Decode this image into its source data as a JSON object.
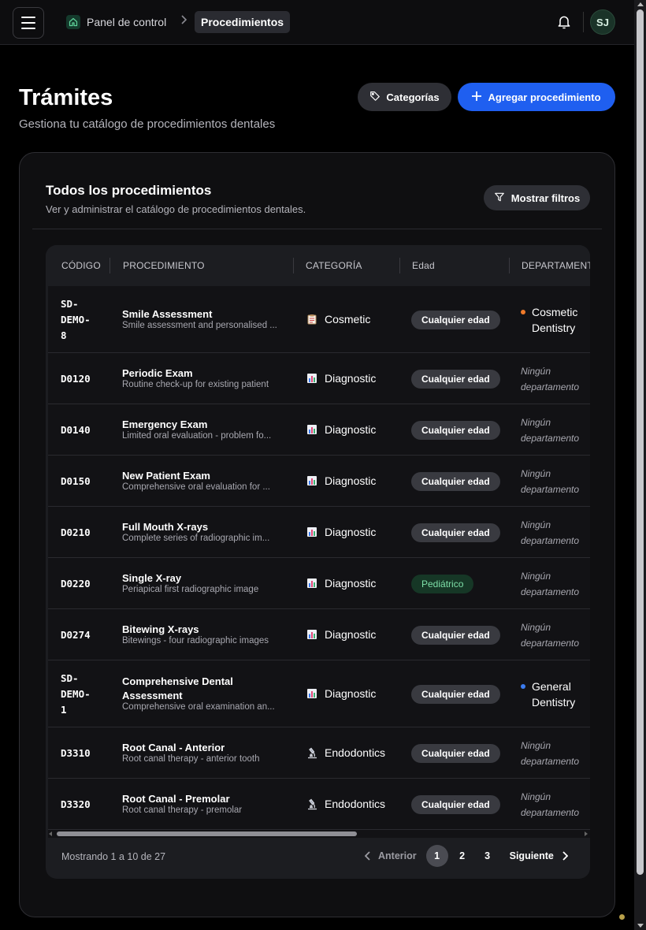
{
  "topbar": {
    "breadcrumb_home": "Panel de control",
    "breadcrumb_current": "Procedimientos",
    "avatar_initials": "SJ"
  },
  "header": {
    "title": "Trámites",
    "subtitle": "Gestiona tu catálogo de procedimientos dentales",
    "categories_button": "Categorías",
    "add_button": "Agregar procedimiento"
  },
  "card": {
    "title": "Todos los procedimientos",
    "subtitle": "Ver y administrar el catálogo de procedimientos dentales.",
    "filter_button": "Mostrar filtros"
  },
  "table": {
    "columns": [
      "CÓDIGO",
      "PROCEDIMIENTO",
      "CATEGORÍA",
      "Edad",
      "DEPARTAMENT"
    ],
    "rows": [
      {
        "code": "SD-DEMO-8",
        "name": "Smile Assessment",
        "desc": "Smile assessment and personalised ...",
        "category": "Cosmetic",
        "cat_icon": "clipboard-icon",
        "age": "Cualquier edad",
        "dept": "Cosmetic Dentistry",
        "dept_color": "#f07a2a"
      },
      {
        "code": "D0120",
        "name": "Periodic Exam",
        "desc": "Routine check-up for existing patient",
        "category": "Diagnostic",
        "cat_icon": "bar-chart-icon",
        "age": "Cualquier edad",
        "dept": "Ningún departamento"
      },
      {
        "code": "D0140",
        "name": "Emergency Exam",
        "desc": "Limited oral evaluation - problem fo...",
        "category": "Diagnostic",
        "cat_icon": "bar-chart-icon",
        "age": "Cualquier edad",
        "dept": "Ningún departamento"
      },
      {
        "code": "D0150",
        "name": "New Patient Exam",
        "desc": "Comprehensive oral evaluation for ...",
        "category": "Diagnostic",
        "cat_icon": "bar-chart-icon",
        "age": "Cualquier edad",
        "dept": "Ningún departamento"
      },
      {
        "code": "D0210",
        "name": "Full Mouth X-rays",
        "desc": "Complete series of radiographic im...",
        "category": "Diagnostic",
        "cat_icon": "bar-chart-icon",
        "age": "Cualquier edad",
        "dept": "Ningún departamento"
      },
      {
        "code": "D0220",
        "name": "Single X-ray",
        "desc": "Periapical first radiographic image",
        "category": "Diagnostic",
        "cat_icon": "bar-chart-icon",
        "age": "Pediátrico",
        "dept": "Ningún departamento"
      },
      {
        "code": "D0274",
        "name": "Bitewing X-rays",
        "desc": "Bitewings - four radiographic images",
        "category": "Diagnostic",
        "cat_icon": "bar-chart-icon",
        "age": "Cualquier edad",
        "dept": "Ningún departamento"
      },
      {
        "code": "SD-DEMO-1",
        "name": "Comprehensive Dental Assessment",
        "desc": "Comprehensive oral examination an...",
        "category": "Diagnostic",
        "cat_icon": "bar-chart-icon",
        "age": "Cualquier edad",
        "dept": "General Dentistry",
        "dept_color": "#3b7cf0"
      },
      {
        "code": "D3310",
        "name": "Root Canal - Anterior",
        "desc": "Root canal therapy - anterior tooth",
        "category": "Endodontics",
        "cat_icon": "microscope-icon",
        "age": "Cualquier edad",
        "dept": "Ningún departamento"
      },
      {
        "code": "D3320",
        "name": "Root Canal - Premolar",
        "desc": "Root canal therapy - premolar",
        "category": "Endodontics",
        "cat_icon": "microscope-icon",
        "age": "Cualquier edad",
        "dept": "Ningún departamento"
      }
    ]
  },
  "footer": {
    "showing": "Mostrando 1 a 10 de 27",
    "prev": "Anterior",
    "next": "Siguiente",
    "pages": [
      "1",
      "2",
      "3"
    ],
    "current_page": "1"
  },
  "colors": {
    "accent": "#1f5ff0",
    "pediatric_text": "#7ee0a8"
  }
}
